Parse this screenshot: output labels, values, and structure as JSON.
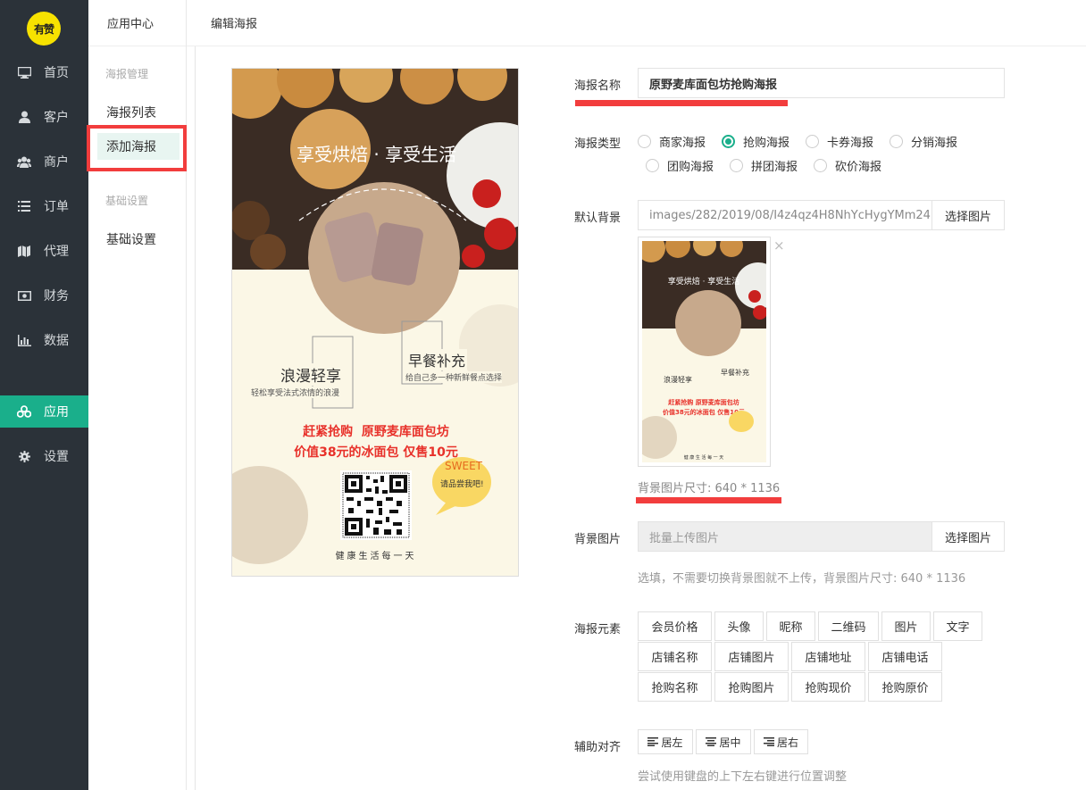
{
  "nav": {
    "logo": "有赞",
    "items": [
      {
        "label": "首页",
        "icon": "monitor-icon"
      },
      {
        "label": "客户",
        "icon": "user-icon"
      },
      {
        "label": "商户",
        "icon": "users-icon"
      },
      {
        "label": "订单",
        "icon": "list-icon"
      },
      {
        "label": "代理",
        "icon": "map-icon"
      },
      {
        "label": "财务",
        "icon": "money-icon"
      },
      {
        "label": "数据",
        "icon": "bar-chart-icon"
      },
      {
        "label": "应用",
        "icon": "apps-icon"
      },
      {
        "label": "设置",
        "icon": "gear-icon"
      }
    ]
  },
  "sub": {
    "title": "应用中心",
    "group1": "海报管理",
    "item_list": "海报列表",
    "item_add": "添加海报",
    "group2": "基础设置",
    "item_basic": "基础设置"
  },
  "header": {
    "title": "编辑海报"
  },
  "poster": {
    "headline": "享受烘焙 · 享受生活",
    "box1_title": "浪漫轻享",
    "box1_sub": "轻松享受法式浓情的浪漫",
    "box2_title": "早餐补充",
    "box2_sub": "给自己多一种新鲜餐点选择",
    "promo1": "赶紧抢购  原野麦库面包坊",
    "promo2": "价值38元的冰面包 仅售10元",
    "bubble1": "SWEET",
    "bubble2": "请品尝我吧!",
    "footer": "健康生活每一天"
  },
  "form": {
    "name_label": "海报名称",
    "name_value": "原野麦库面包坊抢购海报",
    "type_label": "海报类型",
    "types": [
      "商家海报",
      "抢购海报",
      "卡券海报",
      "分销海报",
      "团购海报",
      "拼团海报",
      "砍价海报"
    ],
    "selected_type": "抢购海报",
    "bg_label": "默认背景",
    "bg_value": "images/282/2019/08/I4z4qz4H8NhYcHygYMm24",
    "select_image": "选择图片",
    "close_symbol": "×",
    "bg_size": "背景图片尺寸: 640 * 1136",
    "bgimg_label": "背景图片",
    "bgimg_placeholder": "批量上传图片",
    "bgimg_hint": "选填，不需要切换背景图就不上传，背景图片尺寸: 640 * 1136",
    "elements_label": "海报元素",
    "elements_row1": [
      "会员价格",
      "头像",
      "昵称",
      "二维码",
      "图片",
      "文字"
    ],
    "elements_row2": [
      "店铺名称",
      "店铺图片",
      "店铺地址",
      "店铺电话"
    ],
    "elements_row3": [
      "抢购名称",
      "抢购图片",
      "抢购现价",
      "抢购原价"
    ],
    "align_label": "辅助对齐",
    "align_left": "居左",
    "align_center": "居中",
    "align_right": "居右",
    "align_hint": "尝试使用键盘的上下左右键进行位置调整"
  },
  "colors": {
    "accent": "#1aaf8b",
    "nav_bg": "#2b3239",
    "highlight": "#f23d3d"
  }
}
